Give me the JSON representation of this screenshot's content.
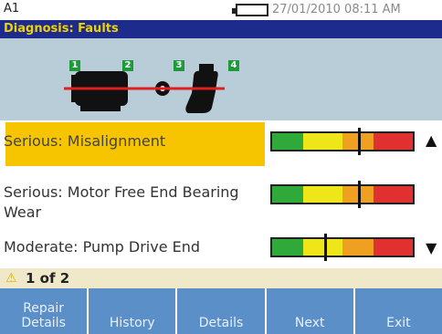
{
  "header": {
    "device_id": "A1",
    "datetime": "27/01/2010 08:11 AM"
  },
  "title": "Diagnosis: Faults",
  "machine": {
    "tags": [
      "1",
      "2",
      "3",
      "4"
    ]
  },
  "faults": [
    {
      "label": "Serious:  Misalignment",
      "severity": 0.62,
      "selected": true
    },
    {
      "label": "Serious: Motor Free End Bearing Wear",
      "severity": 0.62,
      "selected": false
    },
    {
      "label": "Moderate: Pump Drive End",
      "severity": 0.38,
      "selected": false
    }
  ],
  "status": {
    "count_text": "1 of 2"
  },
  "softkeys": [
    "Repair Details",
    "History",
    "Details",
    "Next",
    "Exit"
  ],
  "colors": {
    "title_bg": "#1c2b8c",
    "title_fg": "#f0d200",
    "selected_bg": "#f7c400",
    "softkey_bg": "#5a8fc8",
    "meter": [
      "#2faa3a",
      "#efe61a",
      "#f0a020",
      "#e03030"
    ]
  }
}
